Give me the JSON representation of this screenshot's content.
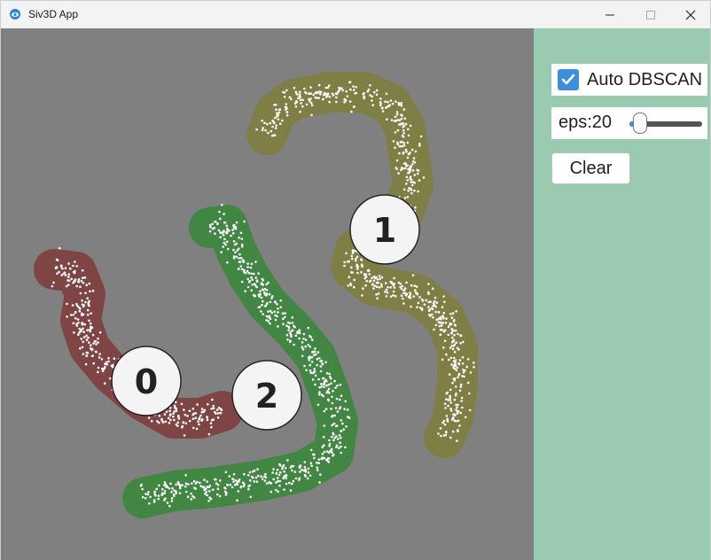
{
  "window": {
    "title": "Siv3D App"
  },
  "controls": {
    "auto_dbscan": {
      "label": "Auto DBSCAN",
      "checked": true
    },
    "eps": {
      "label": "eps:20",
      "slider_fraction": 0.07
    },
    "clear_label": "Clear"
  },
  "clusters": [
    {
      "label": "0",
      "color": "#7f4444"
    },
    {
      "label": "1",
      "color": "#7f7e44"
    },
    {
      "label": "2",
      "color": "#428643"
    }
  ],
  "colors": {
    "canvas": "#808080",
    "panel": "#9acbb1",
    "point": "#ffffff",
    "accent": "#3e8ede"
  }
}
